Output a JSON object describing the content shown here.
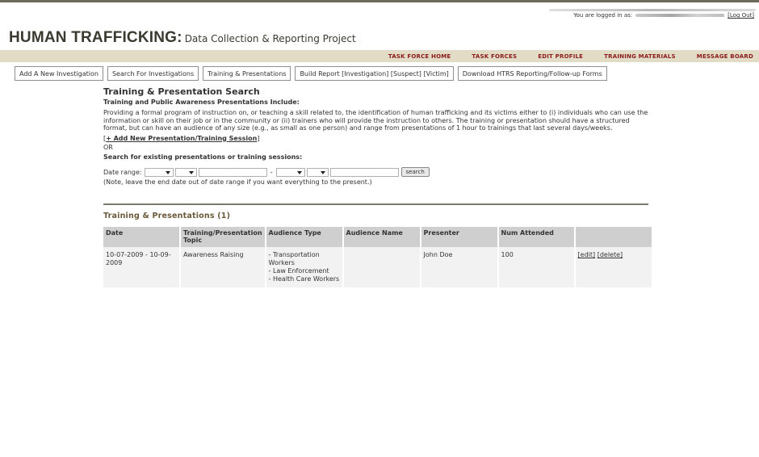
{
  "header": {
    "logged_in_prefix": "You are logged in as:",
    "logout_label": "[Log Out]",
    "title_big": "HUMAN TRAFFICKING:",
    "title_small": "Data Collection & Reporting Project"
  },
  "nav": {
    "items": [
      {
        "label": "TASK FORCE HOME"
      },
      {
        "label": "TASK FORCES"
      },
      {
        "label": "EDIT PROFILE"
      },
      {
        "label": "TRAINING MATERIALS"
      },
      {
        "label": "MESSAGE BOARD"
      }
    ]
  },
  "buttons": [
    {
      "label": "Add A New Investigation"
    },
    {
      "label": "Search For Investigations"
    },
    {
      "label": "Training & Presentations"
    },
    {
      "label": "Build Report [Investigation] [Suspect] [Victim]"
    },
    {
      "label": "Download HTRS Reporting/Follow-up Forms"
    }
  ],
  "search": {
    "title": "Training & Presentation Search",
    "subhead": "Training and Public Awareness Presentations Include:",
    "description": "Providing a formal program of instruction on, or teaching a skill related to, the identification of human trafficking and its victims either to (i) individuals who can use the information or skill on their job or in the community or (ii) trainers who will provide the instruction to others. The training or presentation should have a structured format, but can have an audience of any size (e.g., as small as one person) and range from presentations of 1 hour to trainings that last several days/weeks.",
    "add_link": "+ Add New Presentation/Training Session",
    "or": "OR",
    "search_label": "Search for existing presentations or training sessions:",
    "date_range_label": "Date range:",
    "dash": "-",
    "search_button": "search",
    "note": "(Note, leave the end date out of date range if you want everything to the present.)"
  },
  "results": {
    "title": "Training & Presentations (1)",
    "columns": [
      "Date",
      "Training/Presentation Topic",
      "Audience Type",
      "Audience Name",
      "Presenter",
      "Num Attended",
      ""
    ],
    "rows": [
      {
        "date": "10-07-2009 - 10-09-2009",
        "topic": "Awareness Raising",
        "audience_type": "- Transportation Workers\n- Law Enforcement\n- Health Care Workers",
        "audience_name": "",
        "presenter": "John Doe",
        "num_attended": "100",
        "edit_label": "[edit]",
        "delete_label": "[delete]"
      }
    ]
  }
}
